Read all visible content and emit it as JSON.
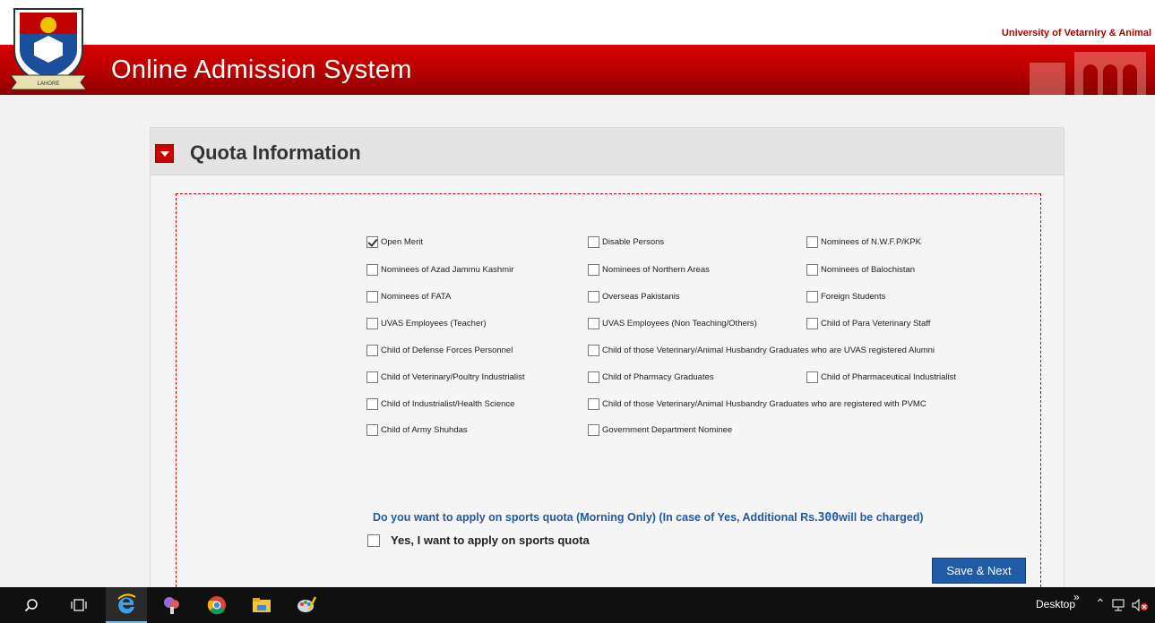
{
  "header": {
    "university_name": "University of Vetarniry & Animal",
    "title": "Online Admission System",
    "logo_text": "LAHORE"
  },
  "panel": {
    "title": "Quota Information",
    "checkboxes": [
      {
        "label": "Open Merit",
        "checked": true
      },
      {
        "label": "Disable Persons",
        "checked": false
      },
      {
        "label": "Nominees of N.W.F.P/KPK",
        "checked": false
      },
      {
        "label": "Nominees of Azad Jammu Kashmir",
        "checked": false
      },
      {
        "label": "Nominees of Northern Areas",
        "checked": false
      },
      {
        "label": "Nominees of Balochistan",
        "checked": false
      },
      {
        "label": "Nominees of FATA",
        "checked": false
      },
      {
        "label": "Overseas Pakistanis",
        "checked": false
      },
      {
        "label": "Foreign Students",
        "checked": false
      },
      {
        "label": "UVAS Employees (Teacher)",
        "checked": false
      },
      {
        "label": "UVAS Employees (Non Teaching/Others)",
        "checked": false
      },
      {
        "label": "Child of Para Veterinary Staff",
        "checked": false
      },
      {
        "label": "Child of Defense Forces Personnel",
        "checked": false
      },
      {
        "label": "Child of those Veterinary/Animal Husbandry Graduates who are UVAS registered Alumni",
        "checked": false
      },
      {
        "label": "Child of Veterinary/Poultry Industrialist",
        "checked": false
      },
      {
        "label": "Child of Pharmacy Graduates",
        "checked": false
      },
      {
        "label": "Child of Pharmaceutical Industrialist",
        "checked": false
      },
      {
        "label": "Child of Industrialist/Health Science",
        "checked": false
      },
      {
        "label": "Child of those Veterinary/Animal Husbandry Graduates who are registered with PVMC",
        "checked": false
      },
      {
        "label": "Child of Army Shuhdas",
        "checked": false
      },
      {
        "label": "Government Department Nominee",
        "checked": false
      }
    ],
    "sports_question_prefix": "Do you want to apply on sports quota (Morning Only) (In case of Yes, Additional Rs.",
    "sports_amount": "300",
    "sports_question_suffix": "will be charged)",
    "sports_checkbox_label": "Yes, I want to apply on sports quota",
    "save_label": "Save & Next"
  },
  "taskbar": {
    "desktop_label": "Desktop",
    "chevron": "»"
  },
  "colors": {
    "brand_red": "#cc0000",
    "link_blue": "#1f5ba6"
  }
}
